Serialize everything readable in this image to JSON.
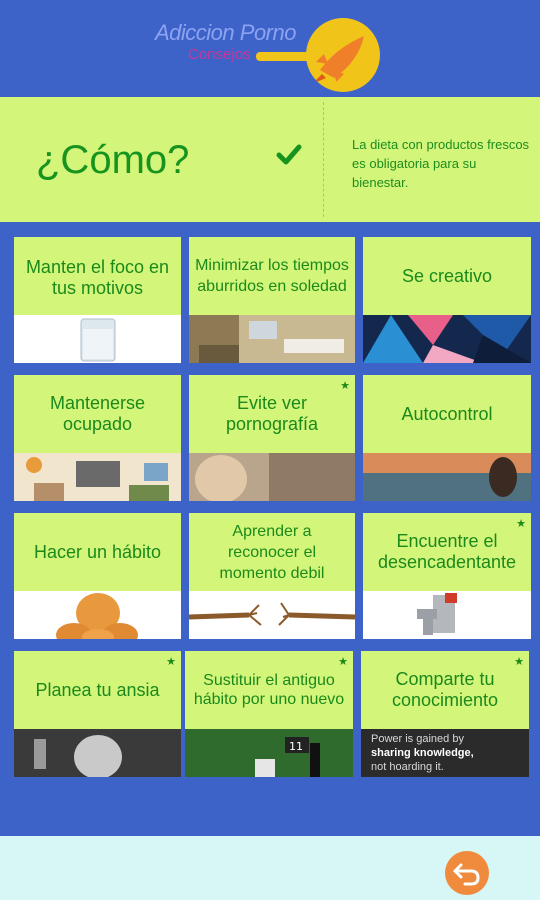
{
  "app": {
    "title": "Adiccion Porno",
    "subtitle": "Consejos"
  },
  "banner": {
    "title": "¿Cómo?",
    "text": "La dieta con productos frescos es obligatoria para su bienestar."
  },
  "tiles": [
    {
      "label": "Manten el foco en tus motivos",
      "starred": false
    },
    {
      "label": "Minimizar los tiempos aburridos en soledad",
      "starred": false
    },
    {
      "label": "Se creativo",
      "starred": false
    },
    {
      "label": "Mantenerse ocupado",
      "starred": false
    },
    {
      "label": "Evite ver pornografía",
      "starred": true
    },
    {
      "label": "Autocontrol",
      "starred": false
    },
    {
      "label": "Hacer un hábito",
      "starred": false
    },
    {
      "label": "Aprender a reconocer el momento debil",
      "starred": false
    },
    {
      "label": "Encuentre el desencadentante",
      "starred": true
    },
    {
      "label": "Planea tu ansia",
      "starred": true
    },
    {
      "label": "Sustituir el antiguo hábito por uno nuevo",
      "starred": true
    },
    {
      "label": "Comparte tu conocimiento",
      "starred": true
    }
  ],
  "share_image_text": {
    "line1": "Power is gained by",
    "line2": "sharing knowledge,",
    "line3": "not hoarding it."
  },
  "icons": {
    "check": "check-icon",
    "star": "star-icon",
    "back": "back-arrow-icon",
    "logo": "rocket-icon"
  },
  "colors": {
    "background": "#3d63c8",
    "tile": "#d2f57a",
    "text": "#1b8a1b",
    "accent": "#f08a3c"
  }
}
